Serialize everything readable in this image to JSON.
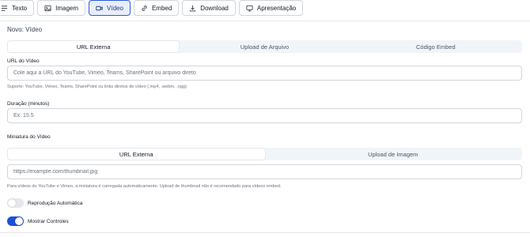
{
  "toolbar": {
    "buttons": [
      {
        "label": "Texto",
        "icon": "text-lines-icon"
      },
      {
        "label": "Imagem",
        "icon": "image-icon"
      },
      {
        "label": "Vídeo",
        "icon": "video-camera-icon"
      },
      {
        "label": "Embed",
        "icon": "link-icon"
      },
      {
        "label": "Download",
        "icon": "download-icon"
      },
      {
        "label": "Apresentação",
        "icon": "monitor-icon"
      }
    ],
    "active_index": 2
  },
  "form": {
    "title": "Novo: Vídeo",
    "source_tabs": [
      "URL Externa",
      "Upload de Arquivo",
      "Código Embed"
    ],
    "source_tabs_selected": 0,
    "video_url": {
      "label": "URL do Vídeo",
      "placeholder": "Cole aqui a URL do YouTube, Vimeo, Teams, SharePoint ou arquivo direto",
      "help": "Suporte: YouTube, Vimeo, Teams, SharePoint ou links diretos de vídeo (.mp4, .webm, .ogg)"
    },
    "duration": {
      "label": "Duração (minutos)",
      "placeholder": "Ex: 15.5"
    },
    "thumbnail": {
      "label": "Miniatura do Vídeo",
      "tabs": [
        "URL Externa",
        "Upload de Imagem"
      ],
      "tabs_selected": 0,
      "placeholder": "https://example.com/thumbnail.jpg",
      "help": "Para vídeos do YouTube e Vimeo, a miniatura é carregada automaticamente. Upload de thumbnail não é recomendado para vídeos embed."
    },
    "autoplay": {
      "label": "Reprodução Automática",
      "on": false
    },
    "controls": {
      "label": "Mostrar Controles",
      "on": true
    }
  },
  "colors": {
    "accent": "#1d4ed8",
    "active_tab_bg": "#e8eefc"
  }
}
